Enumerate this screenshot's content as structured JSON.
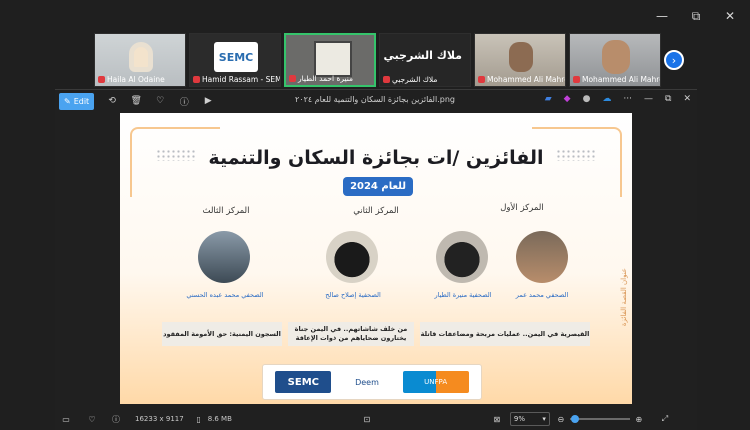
{
  "window_controls": {
    "minimize": "—",
    "restore": "⧉",
    "close": "✕"
  },
  "participants": [
    {
      "name": "Haila Al Odaine"
    },
    {
      "name": "Hamid Rassam - SEMC",
      "logo_text": "SEMC"
    },
    {
      "name": "منيرة احمد الطيار"
    },
    {
      "name": "ملاك الشرجبي",
      "big_name": "ملاك الشرجبي"
    },
    {
      "name": "Mohammed Ali Mahro..."
    },
    {
      "name": "Mohammed Ali Mahro..."
    }
  ],
  "next_icon": "›",
  "photos": {
    "edit_label": "Edit",
    "file_title": "الفائزين بجائزة السكان والتنمية للعام ٢٠٢٤.png",
    "status_dims": "16233 x 9117",
    "status_size": "8.6 MB",
    "zoom": "9%"
  },
  "poster": {
    "title": "الفائزين /ات بجائزة السكان والتنمية",
    "year": "للعام 2024",
    "first_place": "المركز الأول",
    "second_place": "المركز الثاني",
    "third_place": "المركز الثالث",
    "j1": "الصحفي محمد عمر",
    "j2": "الصحفية منيرة الطيار",
    "j3": "الصحفية إصلاح صالح",
    "j4": "الصحفي محمد عبده الحسني",
    "story1": "القيصرية في اليمن.. عمليات مربحة ومضاعفات قاتلة",
    "story2": "من خلف شاشاتهم.. في اليمن جناة يختارون ضحاياهم من ذوات الإعاقة",
    "story3": "السجون اليمنية: حق الأمومة المفقود",
    "side_label": "عنوان القصة الفائزة",
    "logo_semc": "SEMC",
    "logo_deem": "Deem",
    "logo_unfpa": "UNFPA"
  }
}
